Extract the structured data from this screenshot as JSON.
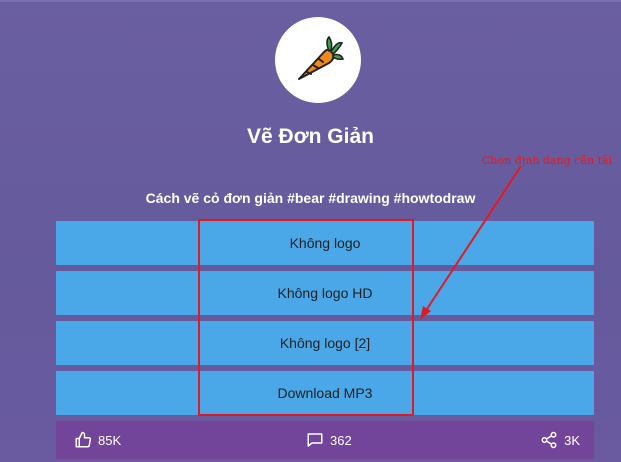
{
  "channel": {
    "name": "Vẽ Đơn Giản",
    "avatar_icon": "carrot-icon"
  },
  "video": {
    "title": "Cách vẽ cỏ đơn giản #bear #drawing #howtodraw"
  },
  "downloads": [
    {
      "label": "Không logo"
    },
    {
      "label": "Không logo HD"
    },
    {
      "label": "Không logo [2]"
    },
    {
      "label": "Download MP3"
    }
  ],
  "annotation": {
    "text": "Chọn định dạng cần tải",
    "color": "#e01b24"
  },
  "stats": {
    "likes": "85K",
    "comments": "362",
    "shares": "3K"
  },
  "colors": {
    "background": "#655a9c",
    "button": "#4aa7e8",
    "footer": "#72449a"
  }
}
